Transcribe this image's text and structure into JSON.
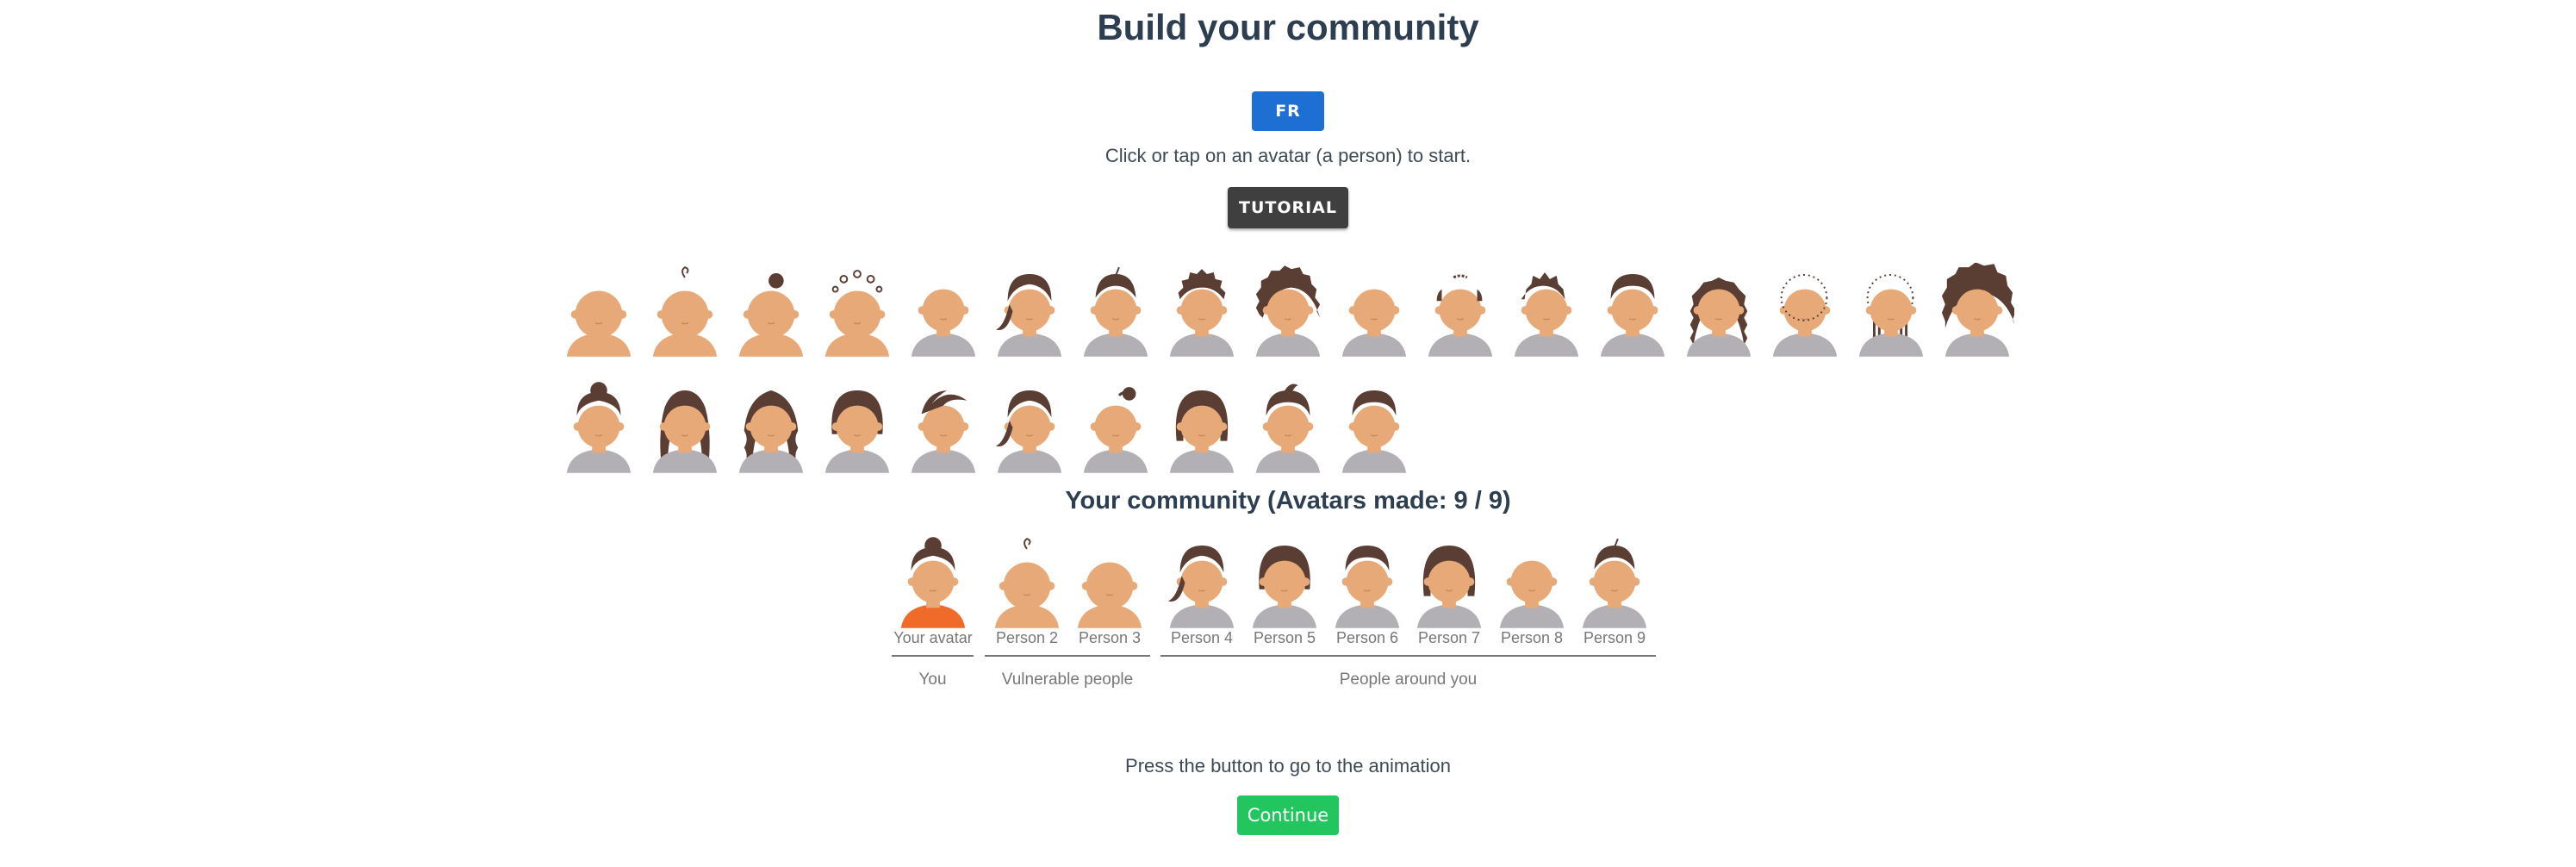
{
  "title": "Build your community",
  "lang_button": "FR",
  "instruction": "Click or tap on an avatar (a person) to start.",
  "tutorial_button": "TUTORIAL",
  "palette": {
    "skin": "#e8a978",
    "skin_dark": "#c98a5c",
    "hair": "#5a3d33",
    "shirt": "#b3b0b5",
    "shirt_you": "#f06a2a",
    "baby_shirt": "#e8a978"
  },
  "avatar_choices": [
    {
      "hair": "bald",
      "body": "baby"
    },
    {
      "hair": "curl",
      "body": "baby"
    },
    {
      "hair": "topknot-small",
      "body": "baby"
    },
    {
      "hair": "baby-curls",
      "body": "baby"
    },
    {
      "hair": "bald",
      "body": "adult"
    },
    {
      "hair": "ponytail-side",
      "body": "adult"
    },
    {
      "hair": "short-sprout",
      "body": "adult"
    },
    {
      "hair": "curly-short",
      "body": "adult"
    },
    {
      "hair": "afro",
      "body": "adult"
    },
    {
      "hair": "bald",
      "body": "adult"
    },
    {
      "hair": "balding",
      "body": "adult"
    },
    {
      "hair": "spiky",
      "body": "adult"
    },
    {
      "hair": "short",
      "body": "adult"
    },
    {
      "hair": "long-curly",
      "body": "adult"
    },
    {
      "hair": "bald-dots",
      "body": "adult"
    },
    {
      "hair": "braids-dots",
      "body": "adult"
    },
    {
      "hair": "big-afro",
      "body": "adult"
    },
    {
      "hair": "bun",
      "body": "adult"
    },
    {
      "hair": "long-straight",
      "body": "adult"
    },
    {
      "hair": "long-wavy",
      "body": "adult"
    },
    {
      "hair": "bob-side",
      "body": "adult"
    },
    {
      "hair": "swoop",
      "body": "adult"
    },
    {
      "hair": "ponytail-side",
      "body": "adult"
    },
    {
      "hair": "bun-side",
      "body": "adult"
    },
    {
      "hair": "bob-bangs",
      "body": "adult"
    },
    {
      "hair": "quiff",
      "body": "adult"
    },
    {
      "hair": "short",
      "body": "adult"
    }
  ],
  "community_title": "Your community (Avatars made: 9 / 9)",
  "community": [
    {
      "label": "Your avatar",
      "hair": "bun",
      "body": "you"
    },
    {
      "label": "Person 2",
      "hair": "curl",
      "body": "baby"
    },
    {
      "label": "Person 3",
      "hair": "bald",
      "body": "baby"
    },
    {
      "label": "Person 4",
      "hair": "ponytail-side",
      "body": "adult"
    },
    {
      "label": "Person 5",
      "hair": "bob-side",
      "body": "adult"
    },
    {
      "label": "Person 6",
      "hair": "short",
      "body": "adult"
    },
    {
      "label": "Person 7",
      "hair": "bob-bangs",
      "body": "adult"
    },
    {
      "label": "Person 8",
      "hair": "bald",
      "body": "adult"
    },
    {
      "label": "Person 9",
      "hair": "short-sprout",
      "body": "adult"
    }
  ],
  "groups": [
    {
      "label": "You"
    },
    {
      "label": "Vulnerable people"
    },
    {
      "label": "People around you"
    }
  ],
  "press_text": "Press the button to go to the animation",
  "continue_button": "Continue"
}
